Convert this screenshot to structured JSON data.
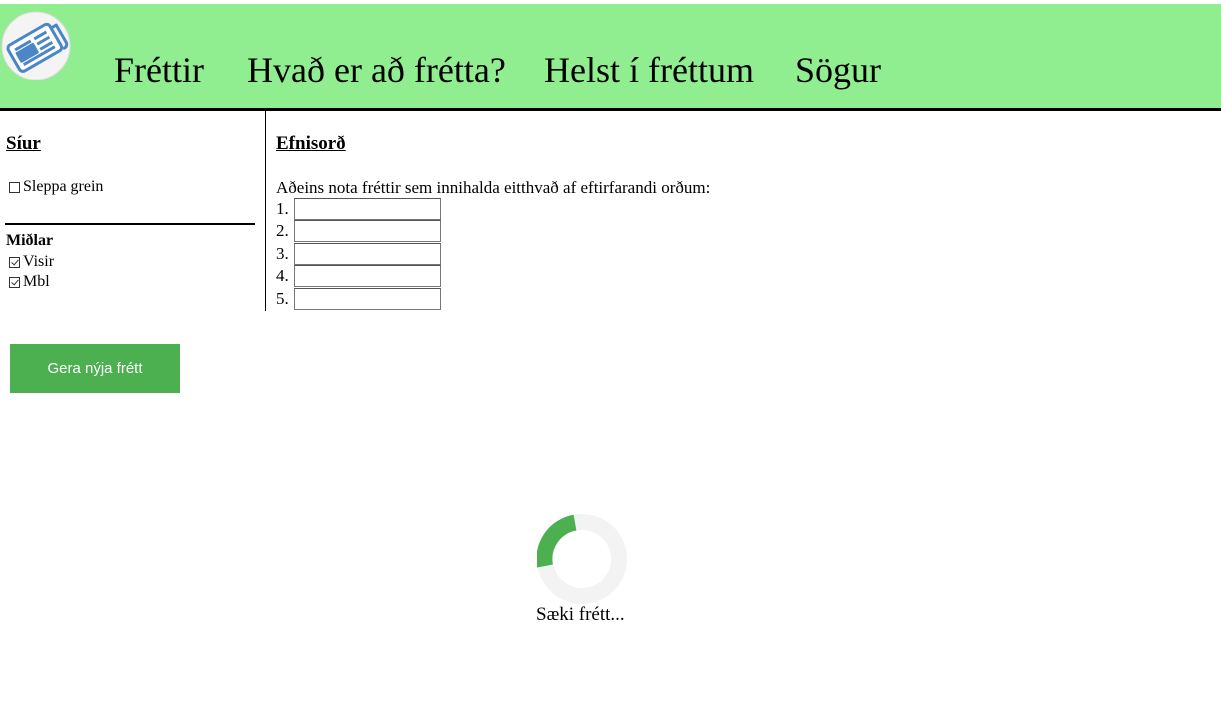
{
  "header": {
    "logo": "newspaper-icon",
    "background": "#90ee90",
    "nav": [
      {
        "label": "Fréttir"
      },
      {
        "label": "Hvað er að frétta?"
      },
      {
        "label": "Helst í fréttum"
      },
      {
        "label": "Sögur"
      }
    ]
  },
  "sidebar": {
    "filters_heading": "Síur",
    "skip_article": {
      "label": "Sleppa grein",
      "checked": false
    },
    "media_heading": "Miðlar",
    "media": [
      {
        "label": "Visir",
        "checked": true
      },
      {
        "label": "Mbl",
        "checked": true
      }
    ]
  },
  "main": {
    "heading": "Efnisorð",
    "description": "Aðeins nota fréttir sem innihalda eitthvað af eftirfarandi orðum:",
    "keywords": [
      {
        "number": "1.",
        "value": ""
      },
      {
        "number": "2.",
        "value": ""
      },
      {
        "number": "3.",
        "value": ""
      },
      {
        "number": "4.",
        "value": ""
      },
      {
        "number": "5.",
        "value": ""
      }
    ]
  },
  "actions": {
    "new_article_label": "Gera nýja frétt",
    "button_color": "#4caf50"
  },
  "loading": {
    "text": "Sæki frétt...",
    "accent": "#4caf50",
    "track": "#f3f3f3"
  }
}
